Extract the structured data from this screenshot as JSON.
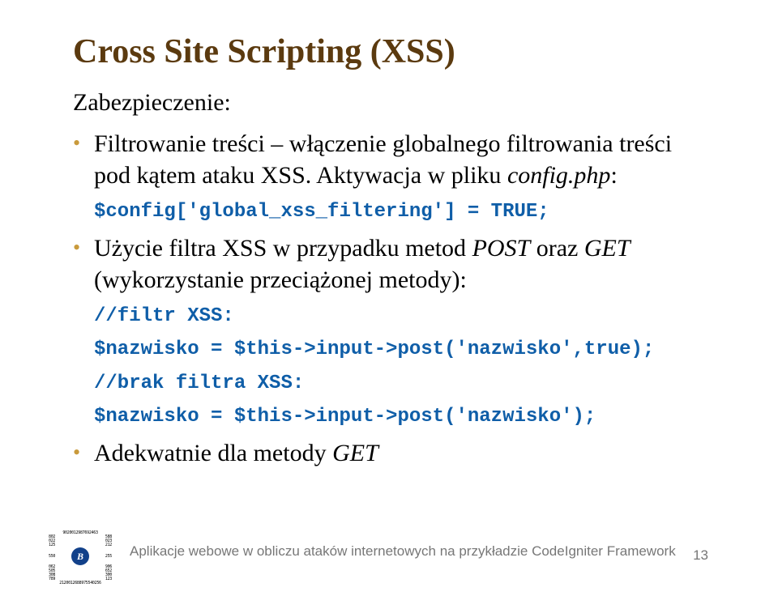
{
  "title": "Cross Site Scripting (XSS)",
  "subtitle": "Zabezpieczenie:",
  "bullet1": {
    "line1": "Filtrowanie treści – włączenie globalnego filtrowania treści pod kątem ataku XSS. Aktywacja w pliku ",
    "italic": "config.php",
    "suffix": ":",
    "code": "$config['global_xss_filtering'] = TRUE;"
  },
  "bullet2": {
    "line1": "Użycie filtra XSS w przypadku metod ",
    "italic1": "POST",
    "mid": " oraz ",
    "italic2": "GET",
    "suffix": " (wykorzystanie przeciążonej metody):",
    "code1": "//filtr XSS:",
    "code2": "$nazwisko = $this->input->post('nazwisko',true);",
    "code3": "//brak filtra XSS:",
    "code4": "$nazwisko = $this->input->post('nazwisko');"
  },
  "bullet3": {
    "line1": "Adekwatnie dla metody ",
    "italic": "GET"
  },
  "footer": "Aplikacje webowe w obliczu ataków internetowych na przykładzie CodeIgniter Framework",
  "page": "13",
  "barcode": {
    "top": "9020012987692463",
    "left1": "802",
    "right1": "588",
    "left2": "022",
    "right2": "023",
    "left3": "125",
    "right3": "212",
    "left4": "550",
    "right4": "255",
    "left5": "062",
    "right5": "906",
    "left6": "505",
    "right6": "652",
    "left7": "308",
    "right7": "300",
    "left8": "789",
    "right8": "123",
    "bottom": "2120012688975540256",
    "letter": "B"
  }
}
